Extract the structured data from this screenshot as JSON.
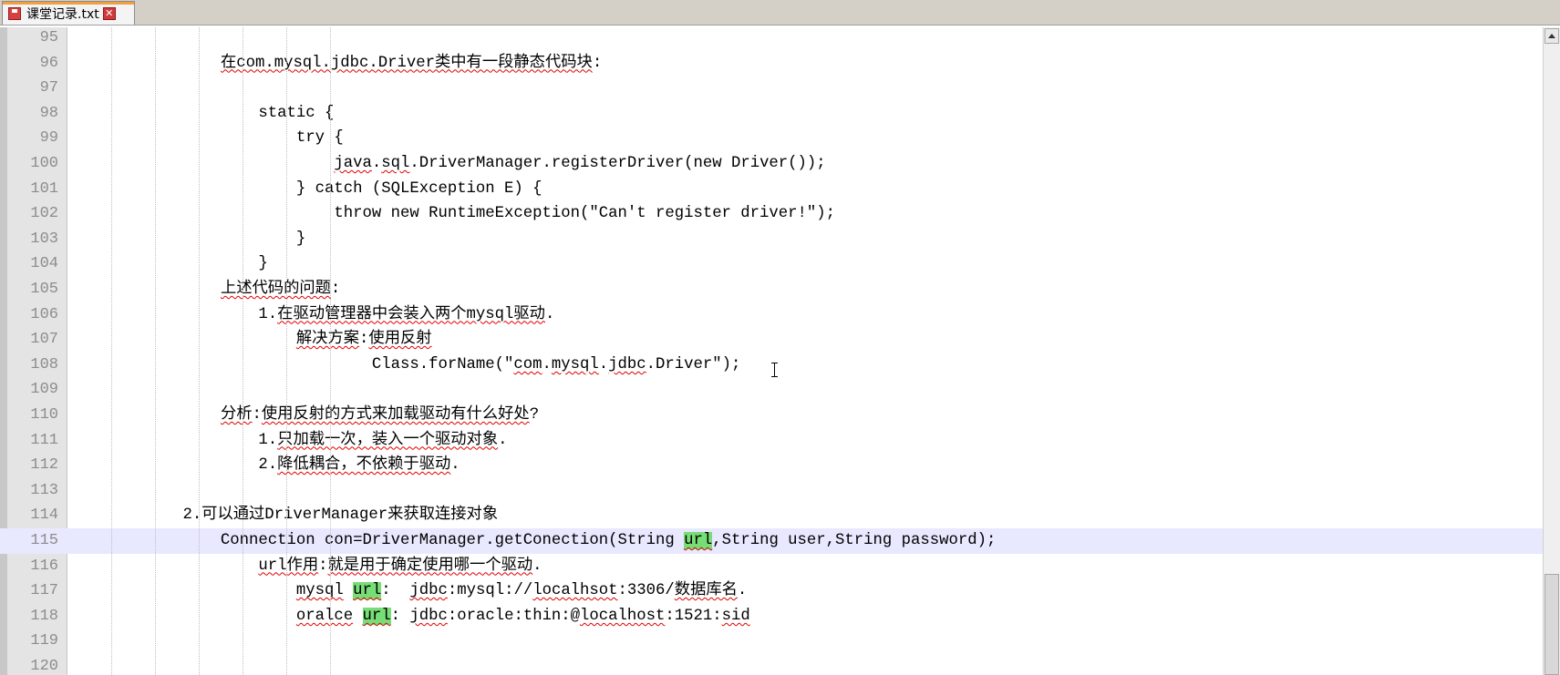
{
  "tab": {
    "title": "课堂记录.txt",
    "save_icon": "save-icon",
    "close_icon": "close-icon"
  },
  "editor": {
    "current_line": 115,
    "colors": {
      "current_line_bg": "#e8e8ff",
      "highlight": "#77dd77",
      "spell_underline": "#e00000"
    },
    "lines": [
      {
        "num": "95",
        "segments": []
      },
      {
        "num": "96",
        "segments": [
          {
            "text": "                "
          },
          {
            "text": "在com.mysql.jdbc.Driver类中有一段静态代码块",
            "cls": "squig"
          },
          {
            "text": ":"
          }
        ]
      },
      {
        "num": "97",
        "segments": []
      },
      {
        "num": "98",
        "segments": [
          {
            "text": "                    static {"
          }
        ]
      },
      {
        "num": "99",
        "segments": [
          {
            "text": "                        try {"
          }
        ]
      },
      {
        "num": "100",
        "segments": [
          {
            "text": "                            "
          },
          {
            "text": "java",
            "cls": "squig"
          },
          {
            "text": "."
          },
          {
            "text": "sql",
            "cls": "squig"
          },
          {
            "text": ".DriverManager.registerDriver(new Driver());"
          }
        ]
      },
      {
        "num": "101",
        "segments": [
          {
            "text": "                        } catch (SQLException E) {"
          }
        ]
      },
      {
        "num": "102",
        "segments": [
          {
            "text": "                            throw new RuntimeException(\"Can't register driver!\");"
          }
        ]
      },
      {
        "num": "103",
        "segments": [
          {
            "text": "                        }"
          }
        ]
      },
      {
        "num": "104",
        "segments": [
          {
            "text": "                    }"
          }
        ]
      },
      {
        "num": "105",
        "segments": [
          {
            "text": "                "
          },
          {
            "text": "上述代码的问题",
            "cls": "squig"
          },
          {
            "text": ":"
          }
        ]
      },
      {
        "num": "106",
        "segments": [
          {
            "text": "                    1."
          },
          {
            "text": "在驱动管理器中会装入两个mysql驱动",
            "cls": "squig"
          },
          {
            "text": "."
          }
        ]
      },
      {
        "num": "107",
        "segments": [
          {
            "text": "                        "
          },
          {
            "text": "解决方案",
            "cls": "squig"
          },
          {
            "text": ":"
          },
          {
            "text": "使用反射",
            "cls": "squig"
          }
        ]
      },
      {
        "num": "108",
        "segments": [
          {
            "text": "                                Class.forName(\""
          },
          {
            "text": "com",
            "cls": "squig"
          },
          {
            "text": "."
          },
          {
            "text": "mysql",
            "cls": "squig"
          },
          {
            "text": "."
          },
          {
            "text": "jdbc",
            "cls": "squig"
          },
          {
            "text": ".Driver\");"
          }
        ]
      },
      {
        "num": "109",
        "segments": []
      },
      {
        "num": "110",
        "segments": [
          {
            "text": "                "
          },
          {
            "text": "分析",
            "cls": "squig"
          },
          {
            "text": ":"
          },
          {
            "text": "使用反射的方式来加载驱动有什么好处",
            "cls": "squig"
          },
          {
            "text": "?"
          }
        ]
      },
      {
        "num": "111",
        "segments": [
          {
            "text": "                    1."
          },
          {
            "text": "只加载一次，装入一个驱动对象",
            "cls": "squig"
          },
          {
            "text": "."
          }
        ]
      },
      {
        "num": "112",
        "segments": [
          {
            "text": "                    2."
          },
          {
            "text": "降低耦合，不依赖于驱动",
            "cls": "squig"
          },
          {
            "text": "."
          }
        ]
      },
      {
        "num": "113",
        "segments": []
      },
      {
        "num": "114",
        "segments": [
          {
            "text": "            2.可以通过DriverManager来获取连接对象"
          }
        ]
      },
      {
        "num": "115",
        "segments": [
          {
            "text": "                Connection con=DriverManager.getConection(String "
          },
          {
            "text": "url",
            "cls": "squig hl"
          },
          {
            "text": ",String user,String password);"
          }
        ]
      },
      {
        "num": "116",
        "segments": [
          {
            "text": "                    "
          },
          {
            "text": "url",
            "cls": "squig"
          },
          {
            "text": "作用",
            "cls": "squig"
          },
          {
            "text": ":"
          },
          {
            "text": "就是用于确定使用哪一个驱动",
            "cls": "squig"
          },
          {
            "text": "."
          }
        ]
      },
      {
        "num": "117",
        "segments": [
          {
            "text": "                        "
          },
          {
            "text": "mysql",
            "cls": "squig"
          },
          {
            "text": " "
          },
          {
            "text": "url",
            "cls": "squig hl"
          },
          {
            "text": ":  "
          },
          {
            "text": "jdbc",
            "cls": "squig"
          },
          {
            "text": ":mysql://"
          },
          {
            "text": "localhsot",
            "cls": "squig"
          },
          {
            "text": ":3306/"
          },
          {
            "text": "数据库名",
            "cls": "squig"
          },
          {
            "text": "."
          }
        ]
      },
      {
        "num": "118",
        "segments": [
          {
            "text": "                        "
          },
          {
            "text": "oralce",
            "cls": "squig"
          },
          {
            "text": " "
          },
          {
            "text": "url",
            "cls": "squig hl"
          },
          {
            "text": ": "
          },
          {
            "text": "jdbc",
            "cls": "squig"
          },
          {
            "text": ":oracle:thin:@"
          },
          {
            "text": "localhost",
            "cls": "squig"
          },
          {
            "text": ":1521:"
          },
          {
            "text": "sid",
            "cls": "squig"
          }
        ]
      },
      {
        "num": "119",
        "segments": []
      },
      {
        "num": "120",
        "segments": []
      }
    ]
  }
}
